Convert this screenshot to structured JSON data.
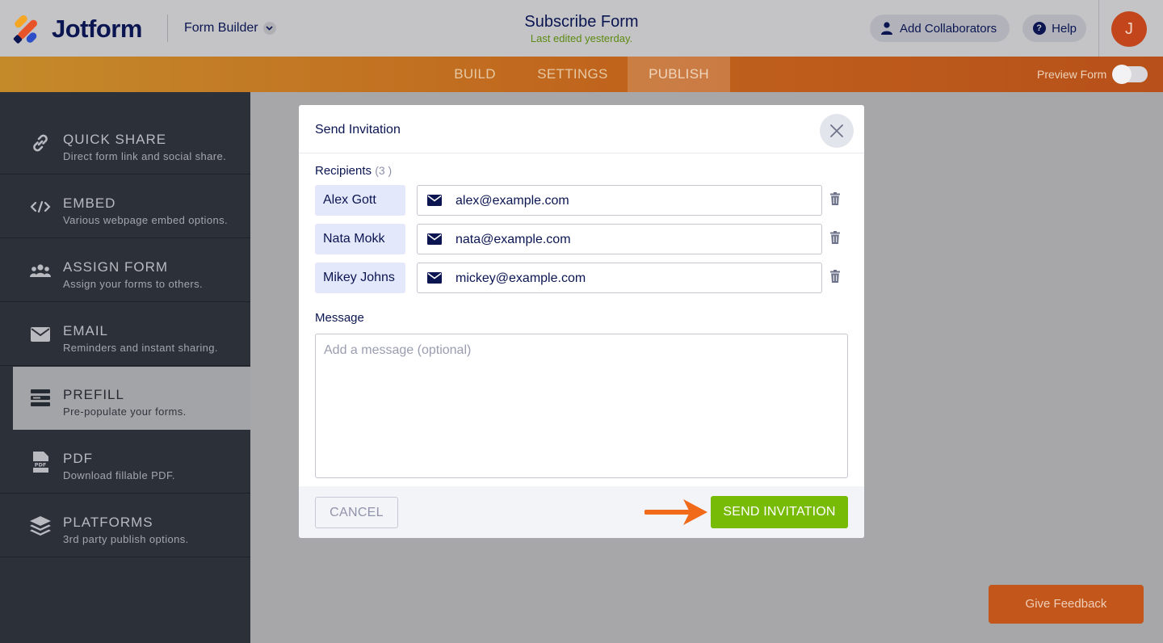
{
  "header": {
    "logo_text": "Jotform",
    "form_builder_label": "Form Builder",
    "form_title": "Subscribe Form",
    "last_edited": "Last edited yesterday.",
    "add_collaborators_label": "Add Collaborators",
    "help_label": "Help",
    "avatar_initial": "J"
  },
  "tabs": [
    {
      "label": "BUILD",
      "active": false
    },
    {
      "label": "SETTINGS",
      "active": false
    },
    {
      "label": "PUBLISH",
      "active": true
    }
  ],
  "preview_form": {
    "label": "Preview Form",
    "enabled": false
  },
  "sidebar": {
    "items": [
      {
        "title": "QUICK SHARE",
        "desc": "Direct form link and social share.",
        "icon": "link-icon"
      },
      {
        "title": "EMBED",
        "desc": "Various webpage embed options.",
        "icon": "code-icon"
      },
      {
        "title": "ASSIGN FORM",
        "desc": "Assign your forms to others.",
        "icon": "users-icon"
      },
      {
        "title": "EMAIL",
        "desc": "Reminders and instant sharing.",
        "icon": "envelope-icon"
      },
      {
        "title": "PREFILL",
        "desc": "Pre-populate your forms.",
        "icon": "prefill-icon",
        "active": true
      },
      {
        "title": "PDF",
        "desc": "Download fillable PDF.",
        "icon": "pdf-icon"
      },
      {
        "title": "PLATFORMS",
        "desc": "3rd party publish options.",
        "icon": "layers-icon"
      }
    ]
  },
  "modal": {
    "title": "Send Invitation",
    "recipients_label": "Recipients",
    "recipients_count": "(3 )",
    "recipients": [
      {
        "name": "Alex Gott",
        "email": "alex@example.com"
      },
      {
        "name": "Nata Mokk",
        "email": "nata@example.com"
      },
      {
        "name": "Mikey Johns",
        "email": "mickey@example.com"
      }
    ],
    "message_label": "Message",
    "message_placeholder": "Add a message (optional)",
    "cancel_label": "CANCEL",
    "send_label": "SEND INVITATION"
  },
  "feedback_label": "Give Feedback",
  "colors": {
    "accent_orange": "#c2561b",
    "send_green": "#78bb07",
    "navy": "#0a1551",
    "sidebar_bg": "#2c3039"
  }
}
